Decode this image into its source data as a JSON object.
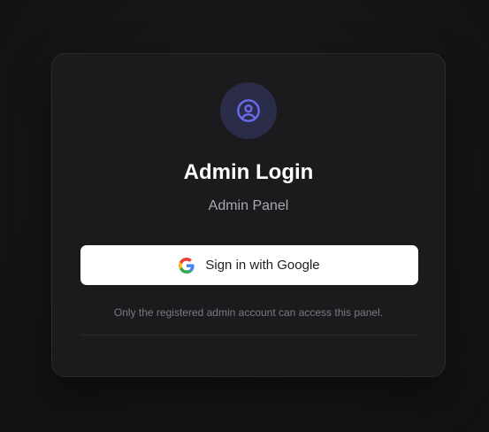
{
  "login": {
    "title": "Admin Login",
    "subtitle": "Admin Panel",
    "google_button_label": "Sign in with Google",
    "note": "Only the registered admin account can access this panel."
  },
  "icons": {
    "avatar": "user-circle-icon",
    "google": "google-g-icon"
  },
  "colors": {
    "accent": "#6b6bf0",
    "avatar_bg": "#2b2b4a",
    "card_bg": "#1b1b1d",
    "page_bg": "#151517"
  }
}
